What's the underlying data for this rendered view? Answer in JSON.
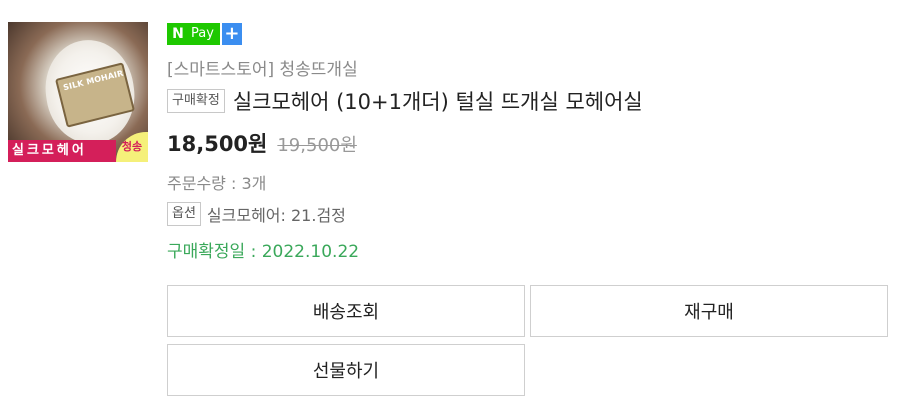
{
  "thumbnail": {
    "yarn_label": "SILK MOHAIR",
    "caption": "실크모헤어",
    "shop_badge": "청송"
  },
  "npay": {
    "n": "N",
    "pay": "Pay",
    "plus": "+"
  },
  "store": {
    "name": "[스마트스토어] 청송뜨개실"
  },
  "order": {
    "status_tag": "구매확정",
    "title": "실크모헤어 (10+1개더) 털실 뜨개실 모헤어실",
    "price": "18,500원",
    "original_price": "19,500원",
    "quantity": "주문수량 : 3개",
    "option_tag": "옵션",
    "option_value": "실크모헤어: 21.검정",
    "confirm_date": "구매확정일 : 2022.10.22"
  },
  "buttons": {
    "track": "배송조회",
    "rebuy": "재구매",
    "gift": "선물하기"
  },
  "colors": {
    "npay_green": "#1ec800",
    "npay_blue": "#3b8ef0",
    "confirm_green": "#3aa85a",
    "caption_pink": "#d41f5a"
  }
}
